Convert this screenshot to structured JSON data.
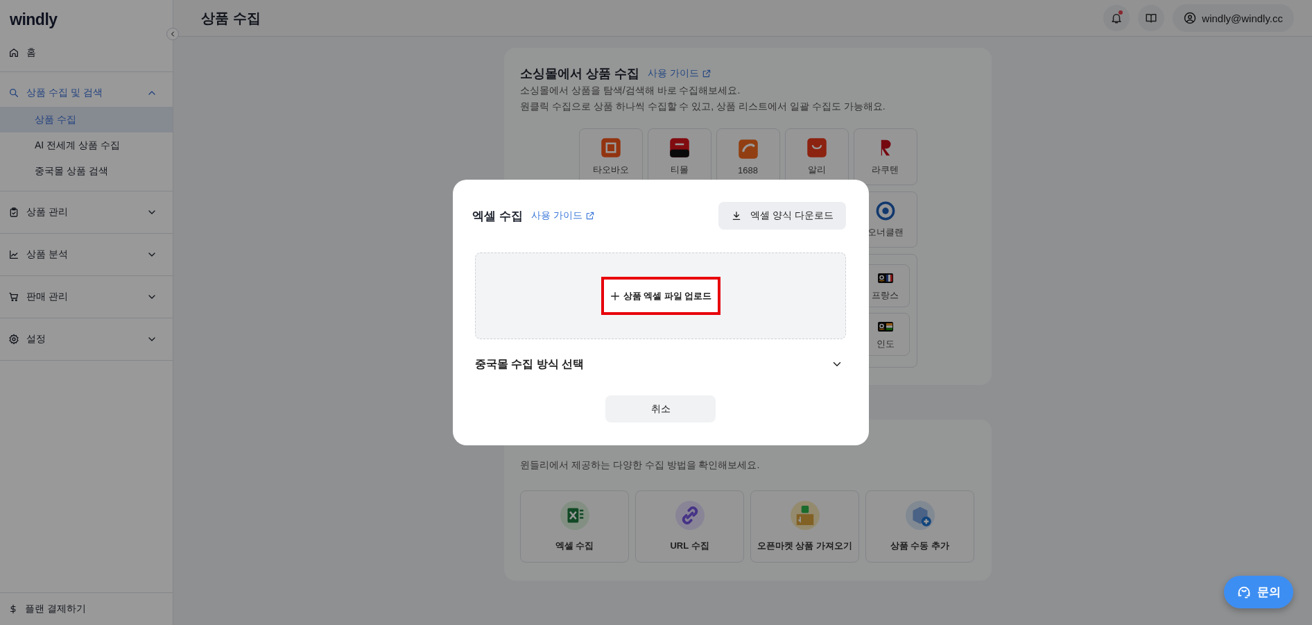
{
  "sidebar": {
    "logo": "windly",
    "nav": [
      {
        "kind": "link",
        "label": "홈"
      },
      {
        "kind": "group",
        "label": "상품 수집 및 검색",
        "expanded": true,
        "children": [
          {
            "label": "상품 수집",
            "selected": true
          },
          {
            "label": "AI 전세계 상품 수집",
            "selected": false
          },
          {
            "label": "중국몰 상품 검색",
            "selected": false
          }
        ]
      },
      {
        "kind": "group",
        "label": "상품 관리",
        "expanded": false
      },
      {
        "kind": "group",
        "label": "상품 분석",
        "expanded": false
      },
      {
        "kind": "group",
        "label": "판매 관리",
        "expanded": false
      },
      {
        "kind": "group",
        "label": "설정",
        "expanded": false
      }
    ],
    "footer": {
      "label": "플랜 결제하기"
    }
  },
  "header": {
    "title": "상품 수집",
    "has_notification": true,
    "account": "windly@windly.cc"
  },
  "sourcing_card": {
    "title": "소싱몰에서 상품 수집",
    "guide_link": "사용 가이드",
    "description": [
      "소싱몰에서 상품을 탐색/검색해 바로 수집해보세요.",
      "원클릭 수집으로 상품 하나씩 수집할 수 있고, 상품 리스트에서 일괄 수집도 가능해요."
    ],
    "marketplaces": [
      {
        "label": "타오바오"
      },
      {
        "label": "티몰"
      },
      {
        "label": "1688"
      },
      {
        "label": "알리"
      },
      {
        "label": "라쿠텐"
      }
    ],
    "more_marketplaces": [
      {
        "label": "오너클랜"
      }
    ],
    "regional_group": [
      {
        "label": "프랑스"
      },
      {
        "label": "인도"
      }
    ]
  },
  "methods_card": {
    "description": "윈들리에서 제공하는 다양한 수집 방법을 확인해보세요.",
    "methods": [
      {
        "label": "엑셀 수집"
      },
      {
        "label": "URL 수집"
      },
      {
        "label": "오픈마켓 상품 가져오기"
      },
      {
        "label": "상품 수동 추가"
      }
    ]
  },
  "modal": {
    "title": "엑셀 수집",
    "guide_link": "사용 가이드",
    "download_button": "엑셀 양식 다운로드",
    "upload_button": "상품 엑셀 파일 업로드",
    "upload_highlighted": true,
    "accordion": {
      "label": "중국몰 수집 방식 선택",
      "expanded": false
    },
    "cancel_button": "취소"
  },
  "chat_button": {
    "label": "문의"
  }
}
